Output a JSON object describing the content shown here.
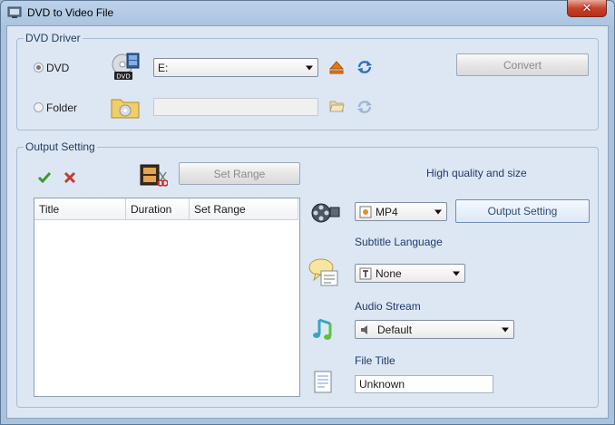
{
  "window": {
    "title": "DVD to Video File",
    "close_glyph": "✕"
  },
  "dvd_driver": {
    "legend": "DVD Driver",
    "dvd_option": "DVD",
    "drive_value": "E:",
    "folder_option": "Folder",
    "folder_path": "",
    "convert_label": "Convert"
  },
  "output_setting": {
    "legend": "Output Setting",
    "set_range_label": "Set Range",
    "quality_text": "High quality and size",
    "columns": [
      "Title",
      "Duration",
      "Set Range"
    ],
    "format_value": "MP4",
    "output_setting_button": "Output Setting",
    "subtitle_label": "Subtitle Language",
    "subtitle_value": "None",
    "audio_label": "Audio Stream",
    "audio_value": "Default",
    "file_title_label": "File Title",
    "file_title_value": "Unknown"
  },
  "colors": {
    "accent": "#1f3a6a",
    "check": "#3a9a2a",
    "cross": "#c23a3a",
    "eject": "#e07a10",
    "refresh": "#2f6fc0"
  }
}
